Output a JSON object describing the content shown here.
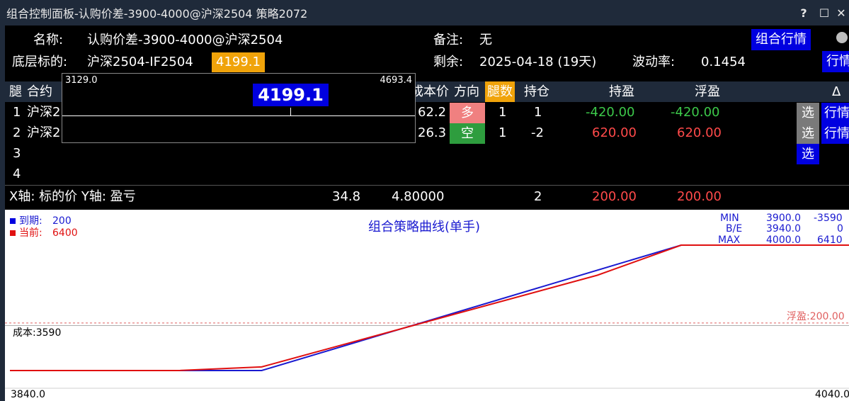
{
  "window": {
    "title": "组合控制面板-认购价差-3900-4000@沪深2504 策略2072",
    "help_glyph": "?",
    "maximize_glyph": "☐",
    "close_glyph": "✕"
  },
  "info": {
    "name_label": "名称:",
    "name_value": "认购价差-3900-4000@沪深2504",
    "underlying_label": "底层标的:",
    "underlying_value": "沪深2504-IF2504",
    "underlying_price": "4199.1",
    "remark_label": "备注:",
    "remark_value": "无",
    "remaining_label": "剩余:",
    "remaining_value": "2025-04-18 (19天)",
    "vol_label": "波动率:",
    "vol_value": "0.1454",
    "combo_quote_button": "组合行情",
    "quote_button": "行情"
  },
  "table": {
    "headers": {
      "leg": "腿",
      "contract": "合约",
      "cost_price": "成本价",
      "direction": "方向",
      "leg_count": "腿数",
      "position": "持仓",
      "hold_pnl": "持盈",
      "float_pnl": "浮盈",
      "delta": "Δ"
    },
    "rows": [
      {
        "idx": "1",
        "contract": "沪深2",
        "cost_price": "62.2",
        "direction": "多",
        "leg_count": "1",
        "position": "1",
        "hold_pnl": "-420.00",
        "float_pnl": "-420.00",
        "select": "选",
        "quote": "行情"
      },
      {
        "idx": "2",
        "contract": "沪深2",
        "cost_price": "26.3",
        "direction": "空",
        "leg_count": "1",
        "position": "-2",
        "hold_pnl": "620.00",
        "float_pnl": "620.00",
        "select": "选",
        "quote": "行情"
      },
      {
        "idx": "3",
        "select": "选"
      },
      {
        "idx": "4"
      }
    ],
    "summary": {
      "axes_label": "X轴: 标的价  Y轴: 盈亏",
      "col1": "34.8",
      "col2": "4.80000",
      "position": "2",
      "hold_pnl": "200.00",
      "float_pnl": "200.00"
    }
  },
  "slider_popup": {
    "min": "3129.0",
    "max": "4693.4",
    "current": "4199.1"
  },
  "colors": {
    "accent_blue": "#0000e0",
    "orange": "#f0a30a",
    "long_bg": "#f08080",
    "short_bg": "#2e9d3e",
    "expiry_line": "#1a1ad0",
    "current_line": "#e01010",
    "titlebar": "#1f2a3a"
  },
  "chart_data": {
    "type": "line",
    "title": "组合策略曲线(单手)",
    "legend": [
      {
        "label": "到期:",
        "value": "200"
      },
      {
        "label": "当前:",
        "value": "6400"
      }
    ],
    "x_range": [
      3840.0,
      4040.0
    ],
    "x_min_label": "3840.0",
    "x_max_label": "4040.0",
    "y_range": [
      -3590,
      6410
    ],
    "stats": [
      {
        "name": "MIN",
        "x": "3900.0",
        "y": "-3590"
      },
      {
        "name": "B/E",
        "x": "3940.0",
        "y": "0"
      },
      {
        "name": "MAX",
        "x": "4000.0",
        "y": "6410"
      }
    ],
    "cost_label": "成本:3590",
    "float_label": "浮盈:200.00",
    "float_value": 200,
    "cost_line_value": 0,
    "series": [
      {
        "name": "到期",
        "color": "#1a1ad0",
        "x": [
          3840,
          3900,
          4000,
          4040
        ],
        "y": [
          -3590,
          -3590,
          6410,
          6410
        ]
      },
      {
        "name": "当前",
        "color": "#e01010",
        "x": [
          3840,
          3880,
          3900,
          3940,
          3980,
          4000,
          4040
        ],
        "y": [
          -3590,
          -3590,
          -3300,
          360,
          4010,
          6410,
          6410
        ]
      }
    ]
  }
}
